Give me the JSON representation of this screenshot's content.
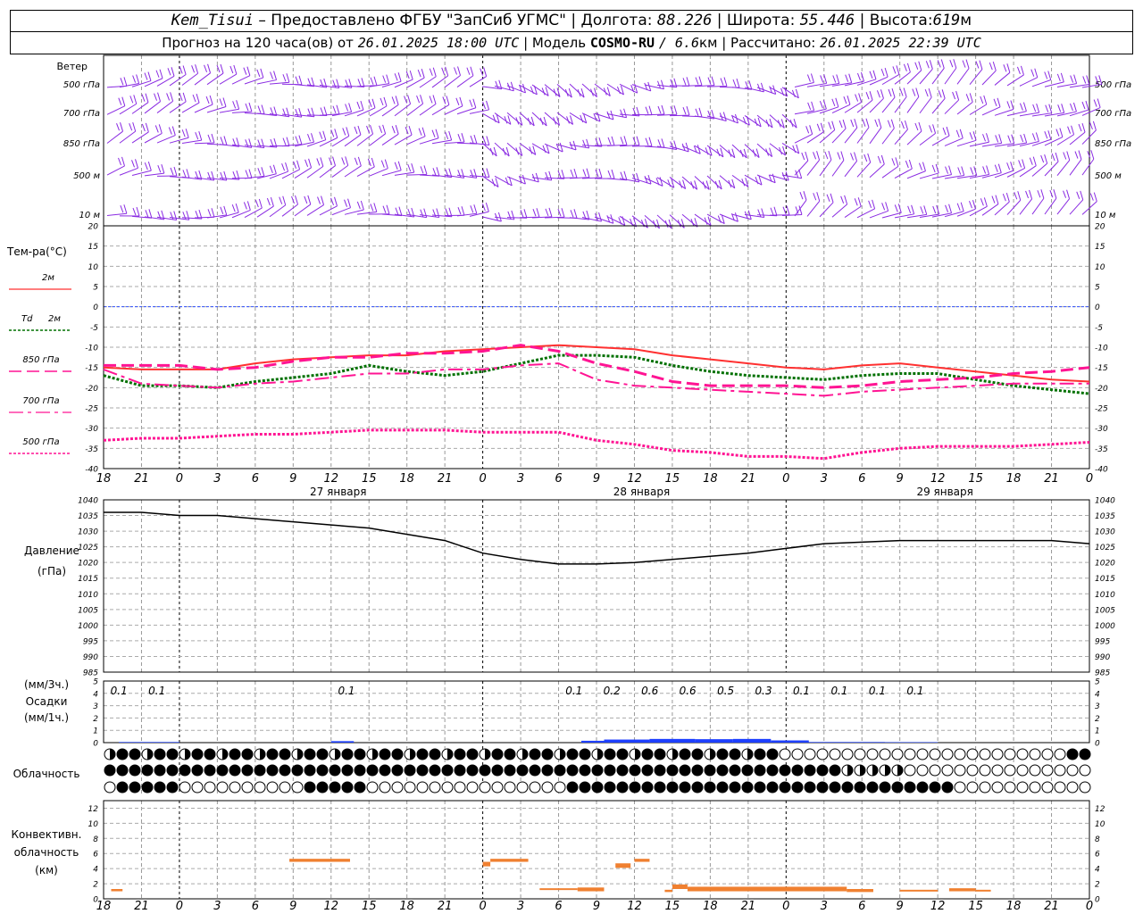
{
  "header": {
    "station": "Kem_Tisui",
    "provider": "– Предоставлено ФГБУ \"ЗапСиб УГМС\" |",
    "lon_label": "Долгота:",
    "lon_value": "88.226",
    "lat_label": "| Широта:",
    "lat_value": "55.446",
    "alt_label": "| Высота:",
    "alt_value": "619",
    "alt_unit": "м",
    "forecast_label": "Прогноз на 120 часа(ов) от",
    "forecast_time": "26.01.2025 18:00 UTC",
    "model_label": "| Модель",
    "model_name": "COSMO-RU",
    "model_res": "/ 6.6",
    "model_res_unit": "км",
    "calc_label": "| Рассчитано:",
    "calc_time": "26.01.2025 22:39 UTC"
  },
  "time_axis": {
    "hour_labels": [
      "18",
      "21",
      "0",
      "3",
      "6",
      "9",
      "12",
      "15",
      "18",
      "21",
      "0",
      "3",
      "6",
      "9",
      "12",
      "15",
      "18",
      "21",
      "0",
      "3",
      "6",
      "9",
      "12",
      "15",
      "18",
      "21",
      "0"
    ],
    "day_labels": [
      {
        "text": "27 января",
        "at_index": 6
      },
      {
        "text": "28 января",
        "at_index": 14
      },
      {
        "text": "29 января",
        "at_index": 22
      }
    ]
  },
  "colors": {
    "wind": "#8a2be2",
    "t2m": "#ff3030",
    "td2m": "#007000",
    "t850": "#ff1493",
    "t700": "#ff1493",
    "t500": "#ff1493",
    "zero_line": "#3050ff",
    "pressure": "#000000",
    "precip": "#1e40ff",
    "conv": "#f08030"
  },
  "wind_panel": {
    "title": "Ветер",
    "levels": [
      "500 гПа",
      "700 гПа",
      "850 гПа",
      "500 м",
      "10  м"
    ],
    "right_levels": [
      "500 гПа",
      "700 гПа",
      "850 гПа",
      "500 м",
      "10  м"
    ]
  },
  "temp_legend": {
    "title": "Тем-ра(°C)",
    "t2m": "2м",
    "td_sym": "Td",
    "td_lvl": "2м",
    "t850": "850 гПа",
    "t700": "700 гПа",
    "t500": "500 гПа"
  },
  "pressure_panel": {
    "title": "Давление",
    "unit": "(гПа)"
  },
  "precip_panel": {
    "unit_top": "(мм/3ч.)",
    "title": "Осадки",
    "unit_bottom": "(мм/1ч.)"
  },
  "cloud_panel": {
    "title": "Облачность"
  },
  "conv_panel": {
    "title1": "Конвективн.",
    "title2": "облачность",
    "unit": "(км)"
  },
  "chart_data": [
    {
      "type": "line",
      "title": "Тем-ра(°C)",
      "x": [
        "18",
        "21",
        "0",
        "3",
        "6",
        "9",
        "12",
        "15",
        "18",
        "21",
        "0",
        "3",
        "6",
        "9",
        "12",
        "15",
        "18",
        "21",
        "0",
        "3",
        "6",
        "9",
        "12",
        "15",
        "18",
        "21",
        "0"
      ],
      "ylim": [
        -40,
        20
      ],
      "yticks": [
        20,
        15,
        10,
        5,
        0,
        -5,
        -10,
        -15,
        -20,
        -25,
        -30,
        -35,
        -40
      ],
      "series": [
        {
          "name": "2м",
          "values": [
            -15,
            -15.5,
            -15.5,
            -15.5,
            -14,
            -13,
            -12.5,
            -12,
            -12,
            -11,
            -10.5,
            -10,
            -9.5,
            -10,
            -10.5,
            -12,
            -13,
            -14,
            -15,
            -15.5,
            -14.5,
            -14,
            -15,
            -16,
            -17,
            -18,
            -18.5
          ]
        },
        {
          "name": "Td 2м",
          "values": [
            -17,
            -19.5,
            -19.5,
            -20,
            -18.5,
            -17.5,
            -16.5,
            -14.5,
            -16,
            -17,
            -16,
            -14,
            -12,
            -12,
            -12.5,
            -14.5,
            -16,
            -17,
            -17.5,
            -18,
            -17,
            -16.5,
            -16.5,
            -18,
            -19.5,
            -20.5,
            -21.5
          ]
        },
        {
          "name": "850 гПа",
          "values": [
            -14.5,
            -14.5,
            -14.5,
            -15.5,
            -15,
            -13.5,
            -12.5,
            -12.5,
            -11.5,
            -11.5,
            -11,
            -9.5,
            -11,
            -14,
            -16,
            -18.5,
            -19.5,
            -19.5,
            -19.5,
            -20,
            -19.5,
            -18.5,
            -18,
            -17.5,
            -16.5,
            -16,
            -15
          ]
        },
        {
          "name": "700 гПа",
          "values": [
            -15.5,
            -19,
            -19.5,
            -20,
            -19,
            -18.5,
            -17.5,
            -16.5,
            -16.5,
            -15.5,
            -15.5,
            -14.5,
            -14,
            -18,
            -19.5,
            -20,
            -20.5,
            -21,
            -21.5,
            -22,
            -21,
            -20.5,
            -20,
            -19.5,
            -19,
            -19,
            -19
          ]
        },
        {
          "name": "500 гПа",
          "values": [
            -33,
            -32.5,
            -32.5,
            -32,
            -31.5,
            -31.5,
            -31,
            -30.5,
            -30.5,
            -30.5,
            -31,
            -31,
            -31,
            -33,
            -34,
            -35.5,
            -36,
            -37,
            -37,
            -37.5,
            -36,
            -35,
            -34.5,
            -34.5,
            -34.5,
            -34,
            -33.5
          ]
        }
      ]
    },
    {
      "type": "line",
      "title": "Давление",
      "ylabel": "(гПа)",
      "x": [
        "18",
        "21",
        "0",
        "3",
        "6",
        "9",
        "12",
        "15",
        "18",
        "21",
        "0",
        "3",
        "6",
        "9",
        "12",
        "15",
        "18",
        "21",
        "0",
        "3",
        "6",
        "9",
        "12",
        "15",
        "18",
        "21",
        "0"
      ],
      "ylim": [
        985,
        1040
      ],
      "yticks": [
        1040,
        1035,
        1030,
        1025,
        1020,
        1015,
        1010,
        1005,
        1000,
        995,
        990,
        985
      ],
      "series": [
        {
          "name": "",
          "values": [
            1036,
            1036,
            1035,
            1035,
            1034,
            1033,
            1032,
            1031,
            1029,
            1027,
            1023,
            1021,
            1019.5,
            1019.5,
            1020,
            1021,
            1022,
            1023,
            1024.5,
            1026,
            1026.5,
            1027,
            1027,
            1027,
            1027,
            1027,
            1026
          ]
        }
      ]
    },
    {
      "type": "bar",
      "title": "Осадки",
      "ylabel": "(мм/3ч.)",
      "ylim": [
        0,
        5
      ],
      "yticks": [
        5,
        4,
        3,
        2,
        1,
        0
      ],
      "labels": [
        {
          "text": "0.1",
          "at_index": 0.5
        },
        {
          "text": "0.1",
          "at_index": 1.5
        },
        {
          "text": "0.1",
          "at_index": 6.5
        },
        {
          "text": "0.1",
          "at_index": 12.5
        },
        {
          "text": "0.2",
          "at_index": 13.5
        },
        {
          "text": "0.6",
          "at_index": 14.5
        },
        {
          "text": "0.6",
          "at_index": 15.5
        },
        {
          "text": "0.5",
          "at_index": 16.5
        },
        {
          "text": "0.3",
          "at_index": 17.5
        },
        {
          "text": "0.1",
          "at_index": 18.5
        },
        {
          "text": "0.1",
          "at_index": 19.5
        },
        {
          "text": "0.1",
          "at_index": 20.5
        },
        {
          "text": "0.1",
          "at_index": 21.5
        }
      ],
      "hourly_bars": [
        {
          "from": 0.4,
          "to": 2.0,
          "value": 0.05
        },
        {
          "from": 6.0,
          "to": 6.6,
          "value": 0.12
        },
        {
          "from": 12.6,
          "to": 13.2,
          "value": 0.15
        },
        {
          "from": 13.2,
          "to": 14.4,
          "value": 0.25
        },
        {
          "from": 14.4,
          "to": 15.6,
          "value": 0.3
        },
        {
          "from": 15.6,
          "to": 16.6,
          "value": 0.28
        },
        {
          "from": 16.6,
          "to": 17.6,
          "value": 0.3
        },
        {
          "from": 17.6,
          "to": 18.6,
          "value": 0.18
        },
        {
          "from": 18.6,
          "to": 20.6,
          "value": 0.05
        },
        {
          "from": 20.6,
          "to": 22.0,
          "value": 0.04
        }
      ]
    },
    {
      "type": "bar",
      "title": "Конвективн. облачность",
      "ylabel": "(км)",
      "ylim": [
        0,
        13
      ],
      "yticks": [
        12,
        10,
        8,
        6,
        4,
        2,
        0
      ],
      "segments": [
        {
          "from": 0.2,
          "to": 0.5,
          "bottom": 1.0,
          "top": 1.3
        },
        {
          "from": 4.9,
          "to": 6.5,
          "bottom": 4.9,
          "top": 5.3
        },
        {
          "from": 10.0,
          "to": 10.2,
          "bottom": 4.3,
          "top": 4.9
        },
        {
          "from": 10.2,
          "to": 11.2,
          "bottom": 4.9,
          "top": 5.3
        },
        {
          "from": 11.5,
          "to": 12.5,
          "bottom": 1.2,
          "top": 1.4
        },
        {
          "from": 12.5,
          "to": 13.2,
          "bottom": 1.0,
          "top": 1.5
        },
        {
          "from": 13.5,
          "to": 13.9,
          "bottom": 4.1,
          "top": 4.7
        },
        {
          "from": 14.0,
          "to": 14.4,
          "bottom": 4.9,
          "top": 5.3
        },
        {
          "from": 14.8,
          "to": 15.0,
          "bottom": 0.9,
          "top": 1.2
        },
        {
          "from": 15.0,
          "to": 15.4,
          "bottom": 1.3,
          "top": 1.9
        },
        {
          "from": 15.4,
          "to": 19.6,
          "bottom": 1.0,
          "top": 1.6
        },
        {
          "from": 19.6,
          "to": 20.3,
          "bottom": 0.9,
          "top": 1.3
        },
        {
          "from": 21.0,
          "to": 22.0,
          "bottom": 1.0,
          "top": 1.2
        },
        {
          "from": 22.3,
          "to": 23.0,
          "bottom": 1.0,
          "top": 1.4
        },
        {
          "from": 23.0,
          "to": 23.4,
          "bottom": 1.0,
          "top": 1.2
        }
      ]
    }
  ]
}
